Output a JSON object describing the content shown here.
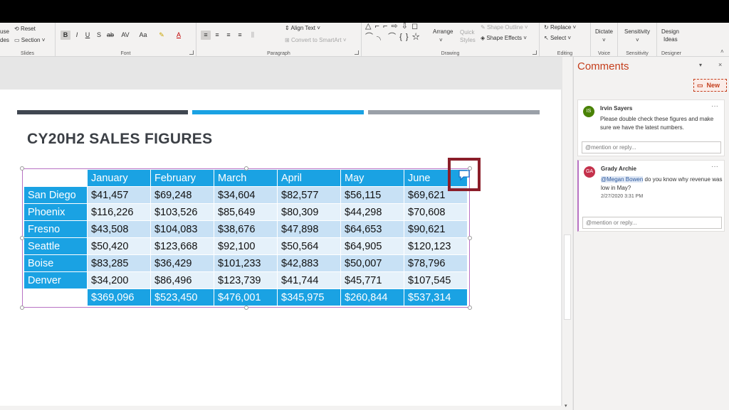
{
  "ribbon": {
    "slides_group": {
      "label": "Slides",
      "use_partial": "use",
      "des_partial": "des",
      "reset": "Reset",
      "section": "Section"
    },
    "font_group": {
      "label": "Font",
      "bold": "B",
      "italic": "I",
      "underline": "U",
      "shadow": "S",
      "strike": "ab",
      "spacing": "AV",
      "case": "Aa",
      "font_color": "A"
    },
    "paragraph_group": {
      "label": "Paragraph",
      "align_text": "Align Text",
      "smartart": "Convert to SmartArt"
    },
    "drawing_group": {
      "label": "Drawing",
      "arrange": "Arrange",
      "quick_styles": "Quick Styles",
      "shape_outline": "Shape Outline",
      "shape_effects": "Shape Effects"
    },
    "editing_group": {
      "label": "Editing",
      "replace": "Replace",
      "select": "Select"
    },
    "voice_group": {
      "label": "Voice",
      "dictate": "Dictate"
    },
    "sensitivity_group": {
      "label": "Sensitivity",
      "sensitivity": "Sensitivity"
    },
    "designer_group": {
      "label": "Designer",
      "design_ideas_1": "Design",
      "design_ideas_2": "Ideas"
    }
  },
  "slide": {
    "title": "CY20H2 SALES FIGURES",
    "bar_colors": [
      "#404751",
      "#1aa2e3",
      "#9aa0a8"
    ],
    "table": {
      "headers": [
        "January",
        "February",
        "March",
        "April",
        "May",
        "June"
      ],
      "rows": [
        {
          "city": "San Diego",
          "values": [
            "$41,457",
            "$69,248",
            "$34,604",
            "$82,577",
            "$56,115",
            "$69,621"
          ]
        },
        {
          "city": "Phoenix",
          "values": [
            "$116,226",
            "$103,526",
            "$85,649",
            "$80,309",
            "$44,298",
            "$70,608"
          ]
        },
        {
          "city": "Fresno",
          "values": [
            "$43,508",
            "$104,083",
            "$38,676",
            "$47,898",
            "$64,653",
            "$90,621"
          ]
        },
        {
          "city": "Seattle",
          "values": [
            "$50,420",
            "$123,668",
            "$92,100",
            "$50,564",
            "$64,905",
            "$120,123"
          ]
        },
        {
          "city": "Boise",
          "values": [
            "$83,285",
            "$36,429",
            "$101,233",
            "$42,883",
            "$50,007",
            "$78,796"
          ]
        },
        {
          "city": "Denver",
          "values": [
            "$34,200",
            "$86,496",
            "$123,739",
            "$41,744",
            "$45,771",
            "$107,545"
          ]
        }
      ],
      "totals": [
        "$369,096",
        "$523,450",
        "$476,001",
        "$345,975",
        "$260,844",
        "$537,314"
      ]
    }
  },
  "comments_pane": {
    "title": "Comments",
    "new_button": "New",
    "threads": [
      {
        "initials": "IS",
        "avatar_color": "#498205",
        "author": "Irvin Sayers",
        "text": "Please double check these figures and make sure we have the latest numbers.",
        "reply_placeholder": "@mention or reply..."
      },
      {
        "initials": "GA",
        "avatar_color": "#c4314b",
        "author": "Grady Archie",
        "mention": "@Megan Bowen",
        "text": " do you know why revenue was low in May?",
        "timestamp": "2/27/2020 3:31 PM",
        "reply_placeholder": "@mention or reply..."
      }
    ]
  },
  "colors": {
    "accent": "#c43e1c",
    "table_header": "#1aa2e3",
    "comment_marker": "#8b1e2a"
  }
}
